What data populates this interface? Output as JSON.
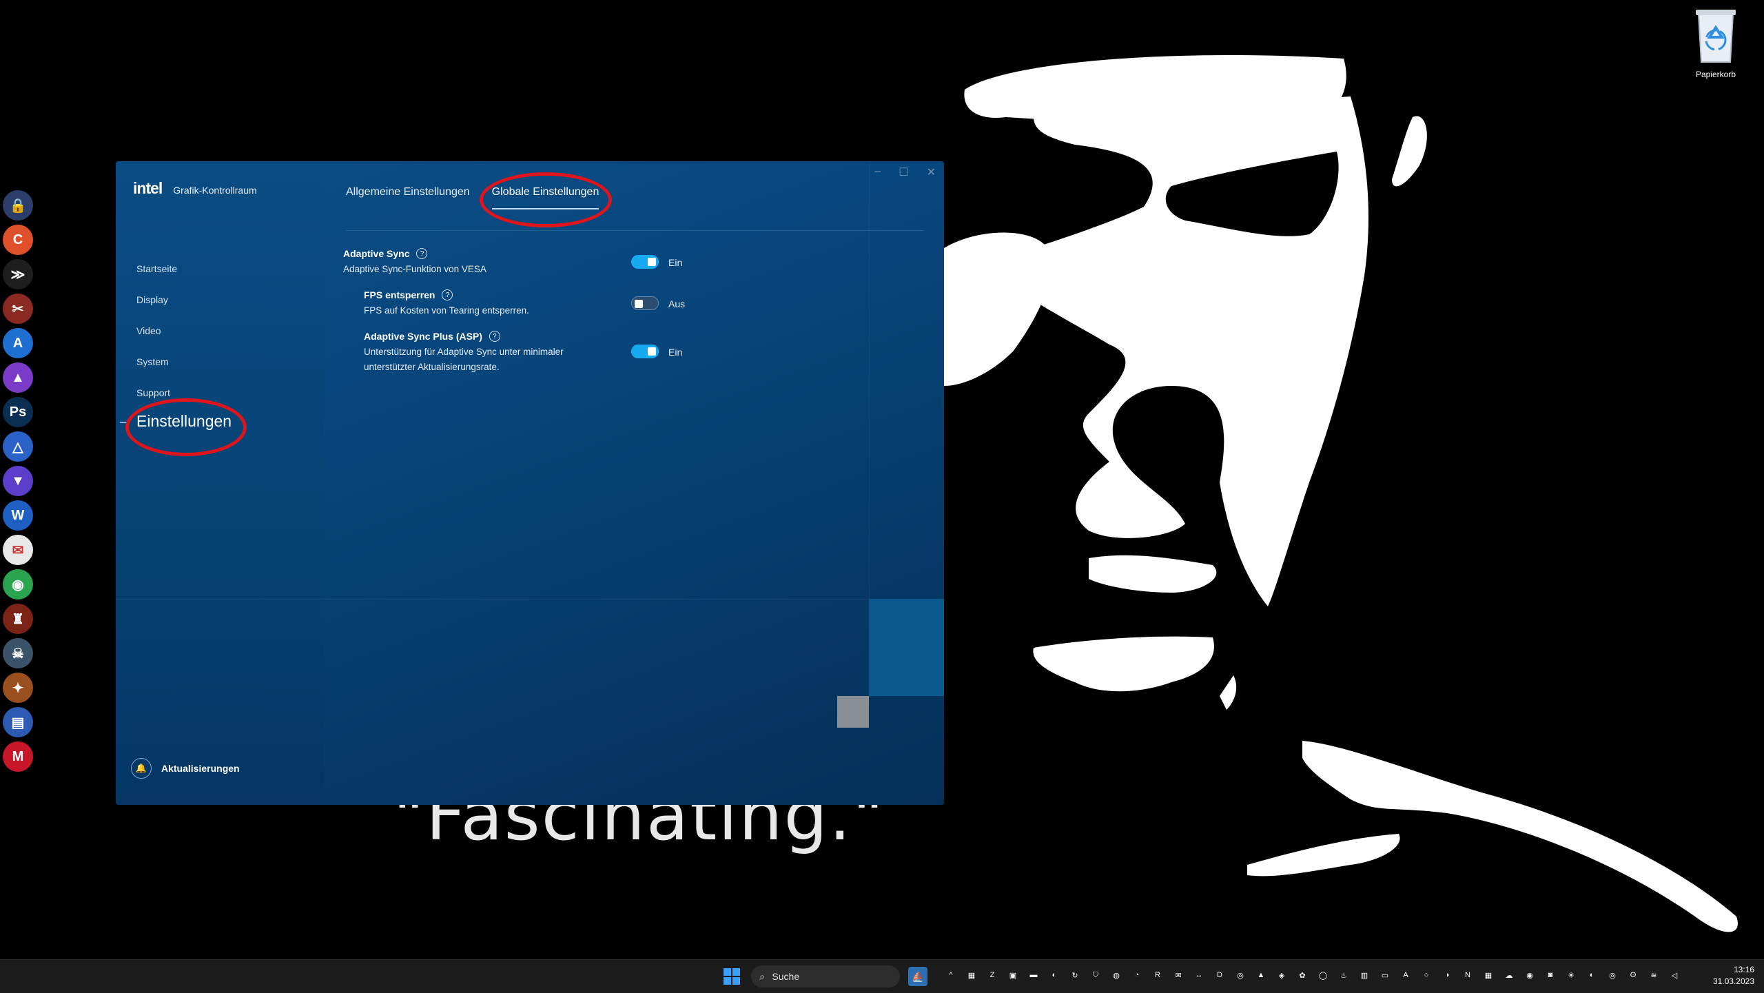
{
  "desktop": {
    "caption": "\"Fascinating.\"",
    "recycle_bin_label": "Papierkorb",
    "dock_icons": [
      {
        "icon": "lock-app-icon",
        "glyph": "🔒",
        "color": "#2c3e6b"
      },
      {
        "icon": "ccleaner-icon",
        "glyph": "C",
        "color": "#e0512b"
      },
      {
        "icon": "swift-app-icon",
        "glyph": "≫",
        "color": "#1e1e1e"
      },
      {
        "icon": "tools-app-icon",
        "glyph": "✂",
        "color": "#8a2a22"
      },
      {
        "icon": "font-app-icon",
        "glyph": "A",
        "color": "#1f6fd1"
      },
      {
        "icon": "affinity-icon",
        "glyph": "▲",
        "color": "#7a3cc8"
      },
      {
        "icon": "photoshop-icon",
        "glyph": "Ps",
        "color": "#0b2f52"
      },
      {
        "icon": "triangle-app-icon",
        "glyph": "△",
        "color": "#2a62c7"
      },
      {
        "icon": "vpn-app-icon",
        "glyph": "▼",
        "color": "#5b3ec9"
      },
      {
        "icon": "word-icon",
        "glyph": "W",
        "color": "#1e5fc4"
      },
      {
        "icon": "stamp-app-icon",
        "glyph": "✉",
        "color": "#e8e8e8"
      },
      {
        "icon": "chrome-icon",
        "glyph": "◉",
        "color": "#2aa44f"
      },
      {
        "icon": "game-app-icon",
        "glyph": "♜",
        "color": "#7a2316"
      },
      {
        "icon": "ghost-app-icon",
        "glyph": "☠",
        "color": "#3a5368"
      },
      {
        "icon": "overwolf-icon",
        "glyph": "✦",
        "color": "#9a4f1f"
      },
      {
        "icon": "printer-icon",
        "glyph": "▤",
        "color": "#2d5bb3"
      },
      {
        "icon": "mcafee-icon",
        "glyph": "M",
        "color": "#c8172b"
      }
    ]
  },
  "window": {
    "brand": "intel",
    "app_title": "Grafik-Kontrollraum",
    "nav": [
      {
        "id": "startseite",
        "label": "Startseite"
      },
      {
        "id": "display",
        "label": "Display"
      },
      {
        "id": "video",
        "label": "Video"
      },
      {
        "id": "system",
        "label": "System"
      },
      {
        "id": "support",
        "label": "Support"
      }
    ],
    "nav_active": "Einstellungen",
    "updates_label": "Aktualisierungen",
    "tabs": [
      {
        "label": "Allgemeine Einstellungen",
        "active": false
      },
      {
        "label": "Globale Einstellungen",
        "active": true
      }
    ],
    "settings": [
      {
        "name": "Adaptive Sync",
        "desc": "Adaptive Sync-Funktion von VESA",
        "state": "on",
        "state_label": "Ein"
      },
      {
        "name": "FPS entsperren",
        "desc": "FPS auf Kosten von Tearing entsperren.",
        "state": "off",
        "state_label": "Aus"
      },
      {
        "name": "Adaptive Sync Plus (ASP)",
        "desc": "Unterstützung für Adaptive Sync unter minimaler unterstützter Aktualisierungsrate.",
        "state": "on",
        "state_label": "Ein"
      }
    ],
    "help_glyph": "?",
    "colors": {
      "accent": "#18aaf0",
      "annotation": "#e0141b"
    }
  },
  "taskbar": {
    "search_placeholder": "Suche",
    "time": "13:16",
    "date": "31.03.2023",
    "tray_icons": [
      "^",
      "▦",
      "Z",
      "▣",
      "▬",
      "◐",
      "↻",
      "⛉",
      "◍",
      "◔",
      "R",
      "✉",
      "↔",
      "D",
      "◎",
      "▲",
      "◈",
      "✿",
      "◯",
      "♨",
      "▥",
      "▭",
      "A",
      "○",
      "◑",
      "N",
      "▦",
      "☁",
      "◉",
      "◙",
      "☀",
      "◐",
      "◎",
      "ʘ",
      "≋",
      "◁"
    ]
  }
}
